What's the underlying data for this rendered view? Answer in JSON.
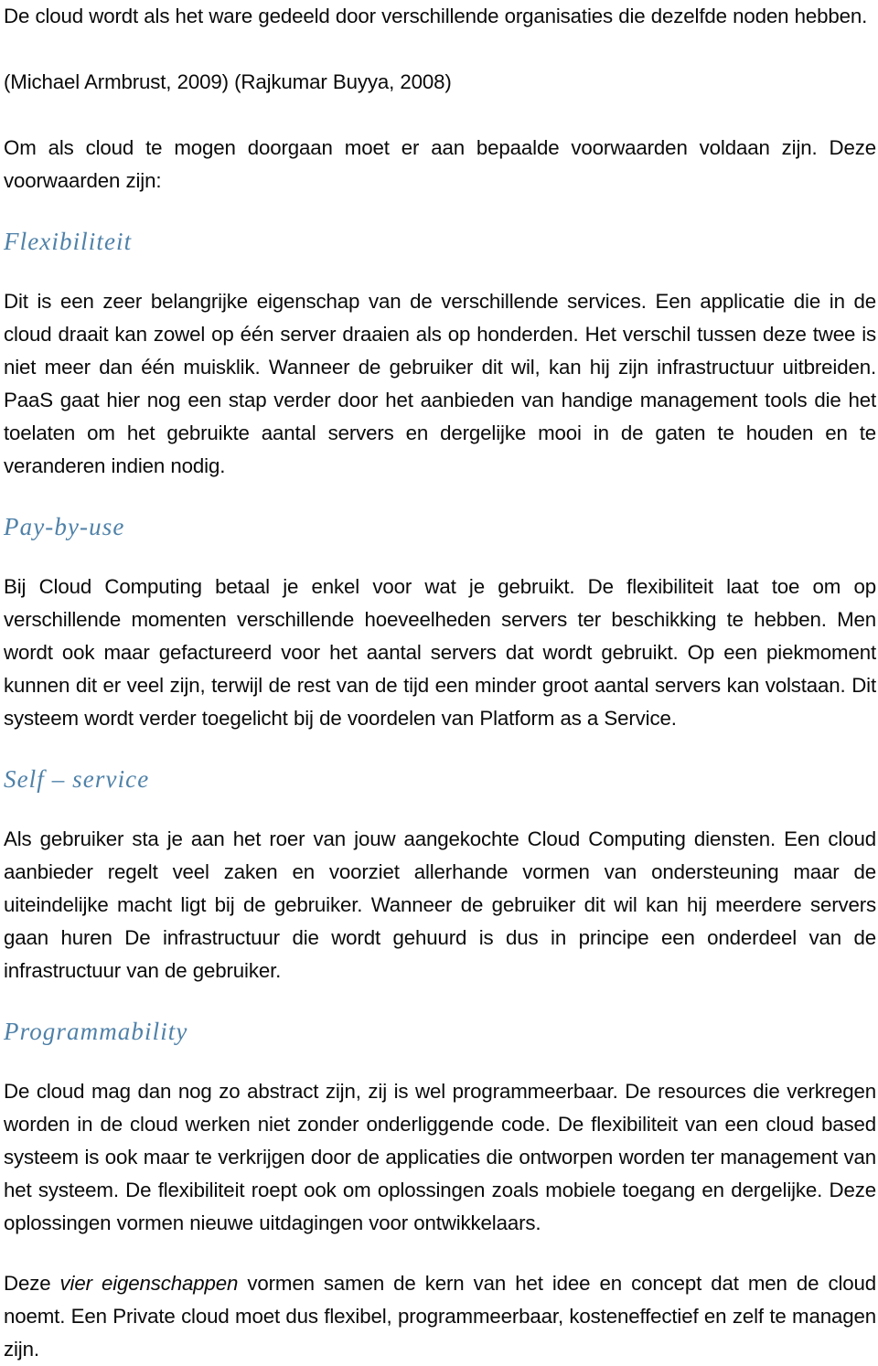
{
  "document": {
    "language": "nl",
    "accent_color": "#4f81a8",
    "text_color": "#0a0a0a",
    "background_color": "#ffffff"
  },
  "content": {
    "intro_paragraph": "De cloud wordt als het ware gedeeld door verschillende organisaties die dezelfde noden hebben.",
    "citations": "(Michael Armbrust, 2009) (Rajkumar Buyya, 2008)",
    "conditions_intro": "Om als cloud te mogen doorgaan moet er aan bepaalde voorwaarden voldaan zijn. Deze voorwaarden zijn:",
    "sections": [
      {
        "heading": "Flexibiliteit",
        "paragraph": "Dit is een zeer belangrijke eigenschap van de verschillende services. Een applicatie die in de cloud draait kan zowel op één server draaien als op honderden. Het verschil tussen deze twee is niet meer dan één muisklik. Wanneer de gebruiker dit wil, kan hij zijn infrastructuur uitbreiden. PaaS gaat hier nog een stap verder door het aanbieden van handige management tools die het toelaten om het gebruikte aantal servers en dergelijke mooi in de gaten te houden en te veranderen indien nodig."
      },
      {
        "heading": "Pay-by-use",
        "paragraph": "Bij Cloud Computing betaal je enkel voor wat je gebruikt. De flexibiliteit laat toe om op verschillende momenten verschillende hoeveelheden servers ter beschikking te hebben. Men wordt ook maar gefactureerd voor het aantal servers dat wordt gebruikt. Op een piekmoment kunnen dit er veel zijn, terwijl de rest van de tijd een minder groot aantal servers kan volstaan. Dit systeem wordt verder toegelicht bij de voordelen van Platform as a Service."
      },
      {
        "heading": "Self – service",
        "paragraph": "Als gebruiker sta je aan het roer van jouw aangekochte Cloud Computing diensten. Een cloud aanbieder regelt veel zaken en voorziet allerhande vormen van ondersteuning maar de uiteindelijke macht ligt bij de gebruiker. Wanneer de gebruiker dit wil kan hij meerdere servers gaan huren De infrastructuur die wordt gehuurd is dus in principe een onderdeel van de infrastructuur van de gebruiker."
      },
      {
        "heading": "Programmability",
        "paragraph": "De cloud mag dan nog zo abstract zijn, zij is wel programmeerbaar. De resources die verkregen worden in de cloud werken niet zonder onderliggende code. De flexibiliteit van een cloud based systeem is ook maar te verkrijgen door de applicaties die ontworpen worden ter management van het systeem. De flexibiliteit roept ook om oplossingen zoals mobiele toegang en dergelijke. Deze oplossingen vormen nieuwe uitdagingen voor ontwikkelaars."
      }
    ],
    "conclusion": {
      "lead": "Deze ",
      "emphasis": "vier eigenschappen",
      "rest": " vormen samen de kern van het idee en concept dat men de cloud noemt. Een Private cloud moet dus flexibel, programmeerbaar, kosteneffectief en zelf te managen zijn."
    }
  }
}
